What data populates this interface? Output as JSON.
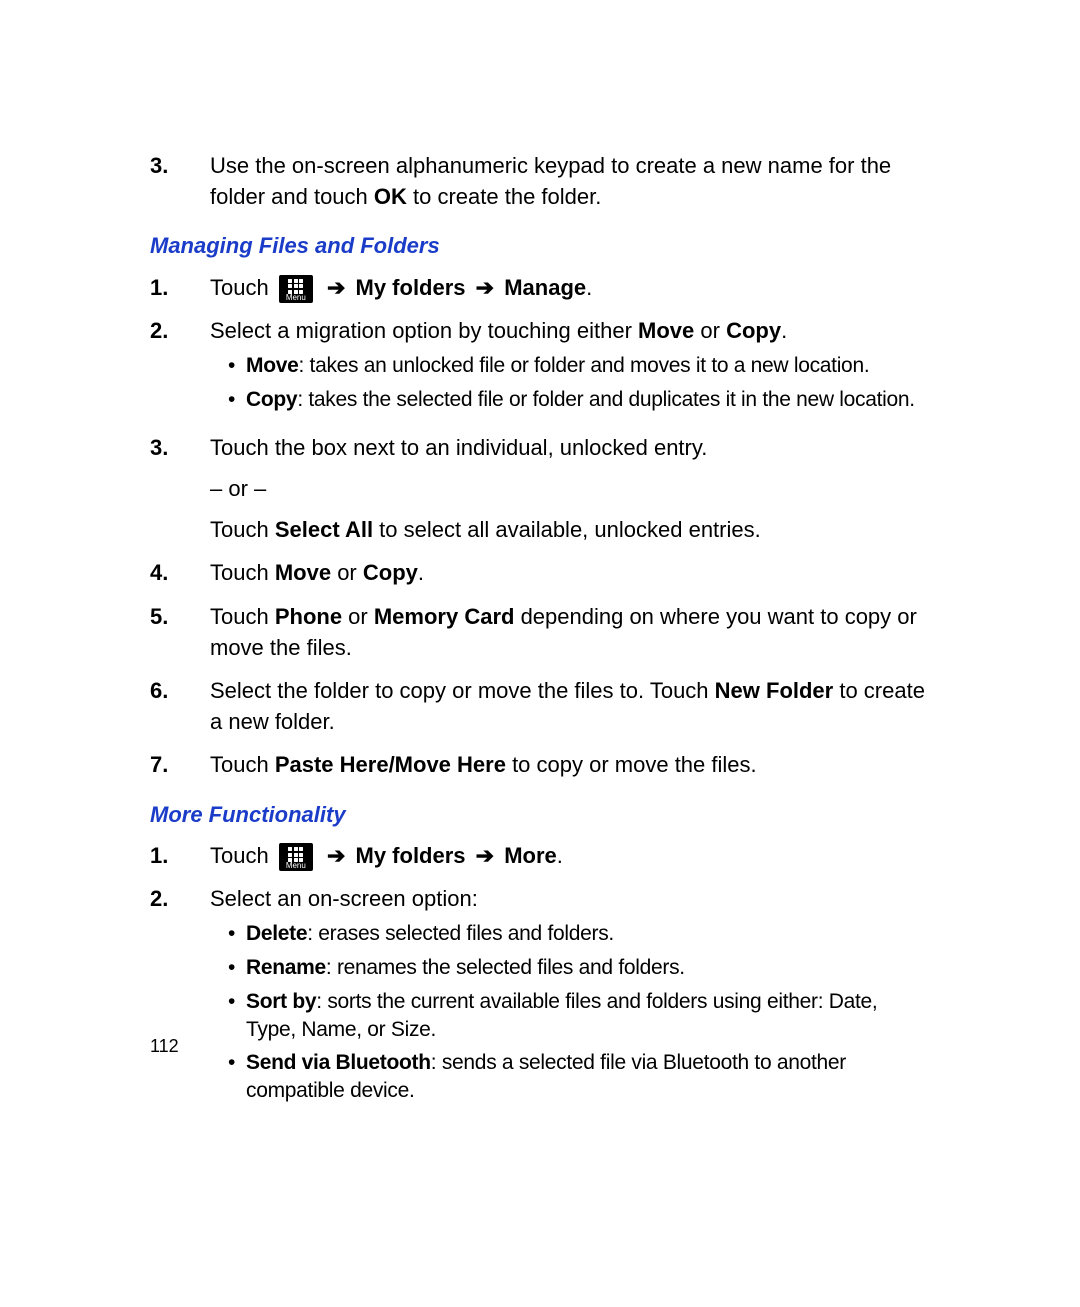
{
  "intro_step": {
    "num": "3.",
    "text_before": "Use the on-screen alphanumeric keypad to create a new name for the folder and touch ",
    "bold": "OK",
    "text_after": " to create the folder."
  },
  "section1": {
    "heading": "Managing Files and Folders",
    "steps": [
      {
        "num": "1.",
        "prefix": "Touch ",
        "icon_label": "Menu",
        "path": [
          " ➔ ",
          "My folders",
          " ➔ ",
          "Manage",
          "."
        ]
      },
      {
        "num": "2.",
        "text_before": "Select a migration option by touching either ",
        "bold1": "Move",
        "mid": " or ",
        "bold2": "Copy",
        "text_after": ".",
        "bullets": [
          {
            "bold": "Move",
            "text": ": takes an unlocked file or folder and moves it to a new location."
          },
          {
            "bold": "Copy",
            "text": ": takes the selected file or folder and duplicates it in the new location."
          }
        ]
      },
      {
        "num": "3.",
        "line1": "Touch the box next to an individual, unlocked entry.",
        "line2": "– or –",
        "line3_before": "Touch ",
        "line3_bold": "Select All",
        "line3_after": " to select all available, unlocked entries."
      },
      {
        "num": "4.",
        "before": "Touch ",
        "bold1": "Move",
        "mid": " or ",
        "bold2": "Copy",
        "after": "."
      },
      {
        "num": "5.",
        "before": "Touch ",
        "bold1": "Phone",
        "mid": " or ",
        "bold2": "Memory Card",
        "after": " depending on where you want to copy or move the files."
      },
      {
        "num": "6.",
        "before": "Select the folder to copy or move the files to. Touch ",
        "bold": "New Folder",
        "after": " to create a new folder."
      },
      {
        "num": "7.",
        "before": "Touch ",
        "bold": "Paste Here/Move Here",
        "after": " to copy or move the files."
      }
    ]
  },
  "section2": {
    "heading": "More Functionality",
    "steps": [
      {
        "num": "1.",
        "prefix": "Touch ",
        "icon_label": "Menu",
        "path": [
          " ➔ ",
          "My folders",
          " ➔ ",
          "More",
          "."
        ]
      },
      {
        "num": "2.",
        "text": "Select an on-screen option:",
        "bullets": [
          {
            "bold": "Delete",
            "text": ": erases selected files and folders."
          },
          {
            "bold": "Rename",
            "text": ": renames the selected files and folders."
          },
          {
            "bold": "Sort by",
            "text": ": sorts the current available files and folders using either: Date, Type, Name, or Size."
          },
          {
            "bold": "Send via Bluetooth",
            "text": ": sends a selected file via Bluetooth to another compatible device."
          }
        ]
      }
    ]
  },
  "page_number": "112"
}
